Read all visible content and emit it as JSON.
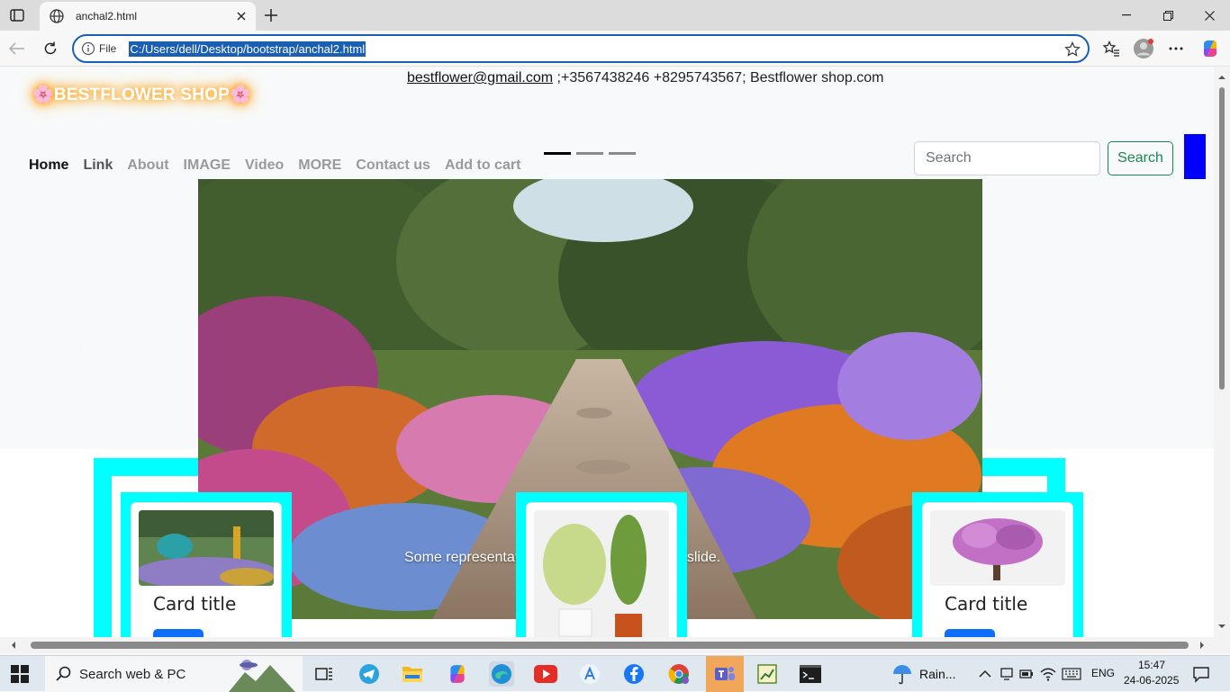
{
  "browser": {
    "tab_title": "anchal2.html",
    "address_scheme_label": "File",
    "url": "C:/Users/dell/Desktop/bootstrap/anchal2.html"
  },
  "page": {
    "brand": "🌸BESTFLOWER SHOP🌸",
    "contact_email": "bestflower@gmail.com",
    "contact_rest": " ;+3567438246 +8295743567; Bestflower shop.com",
    "nav": [
      "Home",
      "Link",
      "About",
      "IMAGE",
      "Video",
      "MORE",
      "Contact us",
      "Add to cart"
    ],
    "search_placeholder": "Search",
    "search_button": "Search",
    "carousel_caption_left": "Some representat",
    "carousel_caption_right": "r the first slide.",
    "card1_title": "Card title",
    "card3_title": "Card title"
  },
  "taskbar": {
    "search_text": "Search web & PC",
    "weather": "Rain...",
    "lang": "ENG",
    "time": "15:47",
    "date": "24-06-2025"
  },
  "colors": {
    "accent_cyan": "#00ffff",
    "brand_glow": "#ff9a00",
    "search_green": "#198754",
    "block_blue": "#0000ff",
    "url_highlight": "#1a5fb4"
  }
}
